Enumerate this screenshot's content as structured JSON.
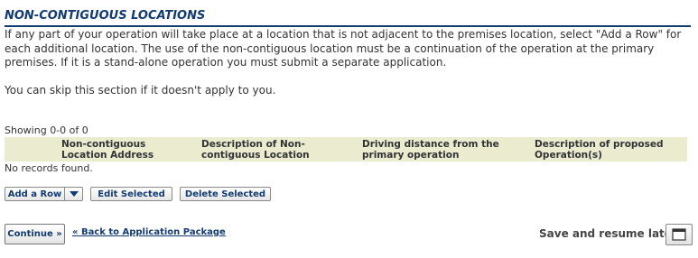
{
  "section": {
    "title": "NON-CONTIGUOUS LOCATIONS",
    "intro": "If any part of your operation will take place at a location that is not adjacent to the premises location, select \"Add a Row\" for each additional location. The use of the non-contiguous location must be a continuation of the operation at the primary premises. If it is a stand-alone operation you must submit a separate application.",
    "skip_note": "You can skip this section if it doesn't apply to you."
  },
  "grid": {
    "showing": "Showing 0-0 of 0",
    "columns": [
      "Non-contiguous Location Address",
      "Description of Non-contiguous Location",
      "Driving distance from the primary operation",
      "Description of proposed Operation(s)"
    ],
    "empty_text": "No records found."
  },
  "toolbar": {
    "add_row": "Add a Row",
    "edit_selected": "Edit Selected",
    "delete_selected": "Delete Selected"
  },
  "footer": {
    "continue": "Continue »",
    "back_link": "« Back to Application Package",
    "save_label": "Save and resume later:"
  },
  "icons": {
    "dropdown": "chevron-down-icon",
    "save": "save-icon"
  },
  "colors": {
    "title": "#123b73",
    "grid_header_bg": "#ebebd0"
  }
}
